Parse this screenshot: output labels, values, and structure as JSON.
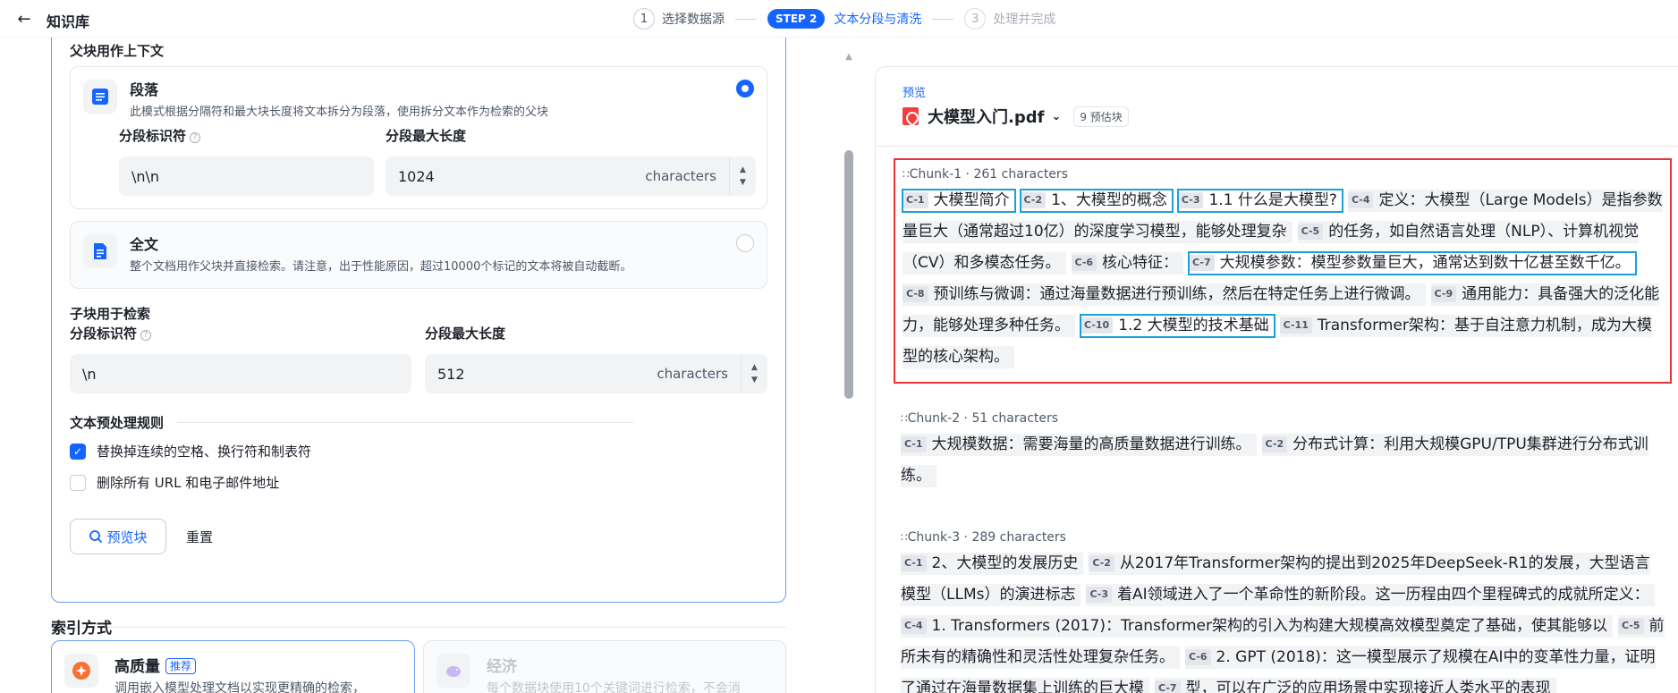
{
  "header": {
    "title": "知识库",
    "steps": [
      {
        "num": "1",
        "label": "选择数据源"
      },
      {
        "pill": "STEP 2",
        "label": "文本分段与清洗"
      },
      {
        "num": "3",
        "label": "处理并完成"
      }
    ]
  },
  "settings": {
    "cut_title": "父块用作上下文",
    "paragraph": {
      "name": "段落",
      "desc": "此模式根据分隔符和最大块长度将文本拆分为段落，使用拆分文本作为检索的父块",
      "sep_label": "分段标识符",
      "sep_value": "\\n\\n",
      "max_label": "分段最大长度",
      "max_value": "1024",
      "unit": "characters"
    },
    "fulltext": {
      "name": "全文",
      "desc": "整个文档用作父块并直接检索。请注意，出于性能原因，超过10000个标记的文本将被自动截断。"
    },
    "child": {
      "title": "子块用于检索",
      "sep_label": "分段标识符",
      "sep_value": "\\n",
      "max_label": "分段最大长度",
      "max_value": "512",
      "unit": "characters"
    },
    "preprocess": {
      "title": "文本预处理规则",
      "rules": [
        {
          "label": "替换掉连续的空格、换行符和制表符",
          "checked": true
        },
        {
          "label": "删除所有 URL 和电子邮件地址",
          "checked": false
        }
      ]
    },
    "preview_button": "预览块",
    "reset_button": "重置",
    "index": {
      "title": "索引方式",
      "high_quality": {
        "name": "高质量",
        "badge": "推荐",
        "desc": "调用嵌入模型处理文档以实现更精确的检索，"
      },
      "economy": {
        "name": "经济",
        "desc": "每个数据块使用10个关键词进行检索，不会消"
      }
    }
  },
  "preview": {
    "label": "预览",
    "file": "大模型入门.pdf",
    "estimate": "9 预估块",
    "chunks": [
      {
        "name": "Chunk-1",
        "chars": "261 characters",
        "segments": [
          {
            "tag": "C-1",
            "text": "大模型简介",
            "hl": true
          },
          {
            "tag": "C-2",
            "text": "1、大模型的概念",
            "hl": true
          },
          {
            "tag": "C-3",
            "text": "1.1 什么是大模型?",
            "hl": true
          },
          {
            "tag": "C-4",
            "text": "定义：大模型（Large Models）是指参数量巨大（通常超过10亿）的深度学习模型，能够处理复杂"
          },
          {
            "tag": "C-5",
            "text": "的任务，如自然语言处理（NLP）、计算机视觉（CV）和多模态任务。"
          },
          {
            "tag": "C-6",
            "text": "核心特征："
          },
          {
            "tag": "C-7",
            "text": "大规模参数：模型参数量巨大，通常达到数十亿甚至数千亿。",
            "hl": true
          },
          {
            "tag": "C-8",
            "text": "预训练与微调：通过海量数据进行预训练，然后在特定任务上进行微调。"
          },
          {
            "tag": "C-9",
            "text": "通用能力：具备强大的泛化能力，能够处理多种任务。"
          },
          {
            "tag": "C-10",
            "text": "1.2 大模型的技术基础",
            "hl": true
          },
          {
            "tag": "C-11",
            "text": "Transformer架构：基于自注意力机制，成为大模型的核心架构。"
          }
        ]
      },
      {
        "name": "Chunk-2",
        "chars": "51 characters",
        "segments": [
          {
            "tag": "C-1",
            "text": "大规模数据：需要海量的高质量数据进行训练。"
          },
          {
            "tag": "C-2",
            "text": "分布式计算：利用大规模GPU/TPU集群进行分布式训练。"
          }
        ]
      },
      {
        "name": "Chunk-3",
        "chars": "289 characters",
        "segments": [
          {
            "tag": "C-1",
            "text": "2、大模型的发展历史"
          },
          {
            "tag": "C-2",
            "text": "从2017年Transformer架构的提出到2025年DeepSeek-R1的发展，大型语言模型（LLMs）的演进标志"
          },
          {
            "tag": "C-3",
            "text": "着AI领域进入了一个革命性的新阶段。这一历程由四个里程碑式的成就所定义："
          },
          {
            "tag": "C-4",
            "text": "1. Transformers (2017)：Transformer架构的引入为构建大规模高效模型奠定了基础，使其能够以"
          },
          {
            "tag": "C-5",
            "text": "前所未有的精确性和灵活性处理复杂任务。"
          },
          {
            "tag": "C-6",
            "text": "2. GPT (2018)：这一模型展示了规模在AI中的变革性力量，证明了通过在海量数据集上训练的巨大模"
          },
          {
            "tag": "C-7",
            "text": "型，可以在广泛的应用场景中实现接近人类水平的表现"
          }
        ]
      }
    ]
  }
}
